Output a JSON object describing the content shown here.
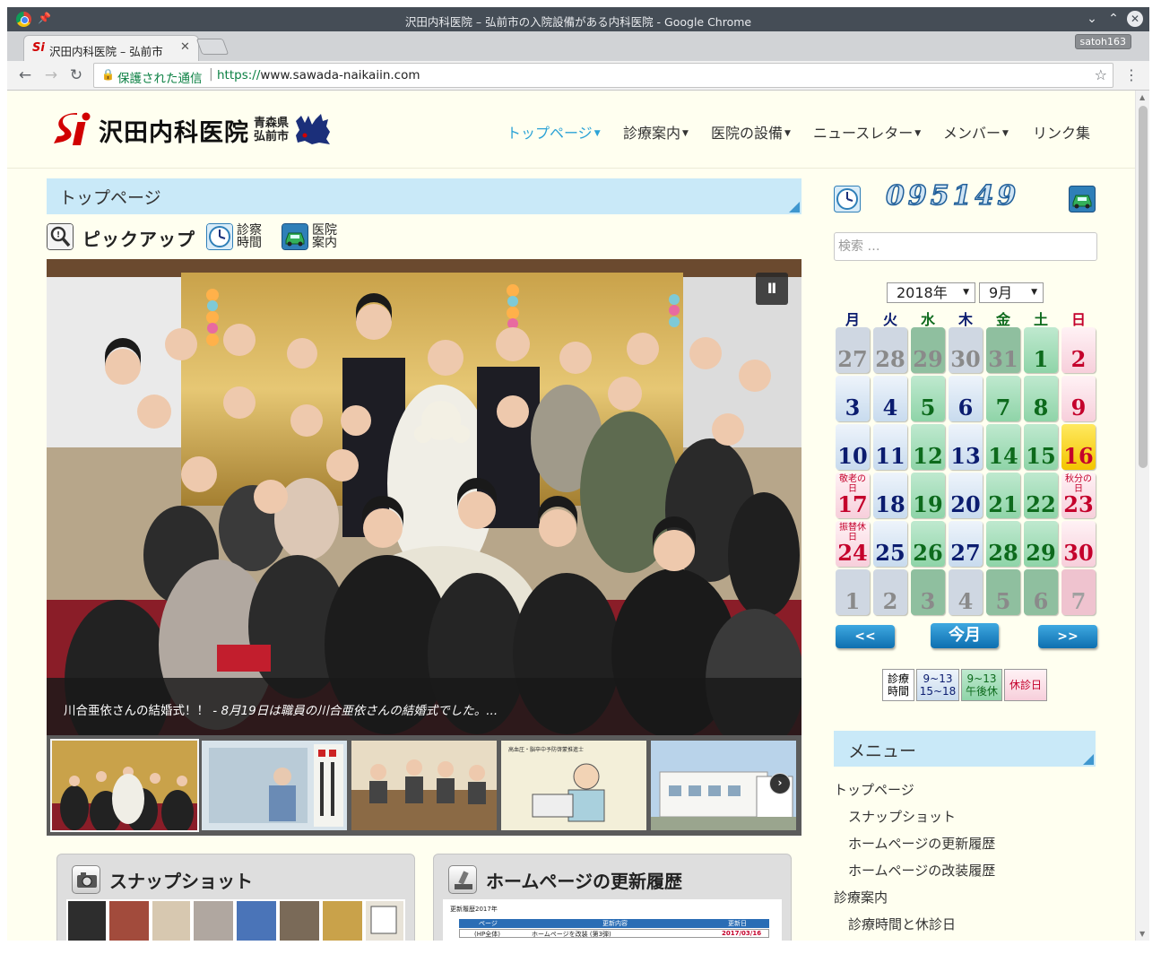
{
  "window": {
    "title": "沢田内科医院 – 弘前市の入院設備がある内科医院 - Google Chrome",
    "tab_title": "沢田内科医院 – 弘前市",
    "profile": "satoh163"
  },
  "address_bar": {
    "security_label": "保護された通信",
    "url_scheme": "https://",
    "url_rest": "www.sawada-naikaiin.com"
  },
  "site": {
    "logo_text": "沢田内科医院",
    "prefecture_line1": "青森県",
    "prefecture_line2": "弘前市",
    "nav": [
      {
        "label": "トップページ",
        "dropdown": true,
        "active": true
      },
      {
        "label": "診療案内",
        "dropdown": true
      },
      {
        "label": "医院の設備",
        "dropdown": true
      },
      {
        "label": "ニュースレター",
        "dropdown": true
      },
      {
        "label": "メンバー",
        "dropdown": true
      },
      {
        "label": "リンク集",
        "dropdown": false
      }
    ]
  },
  "main": {
    "page_title": "トップページ",
    "pickup_label": "ピックアップ",
    "hours_line1": "診察",
    "hours_line2": "時間",
    "clinic_line1": "医院",
    "clinic_line2": "案内",
    "slide_caption_title": "川合亜依さんの結婚式！！",
    "slide_caption_sep": " - ",
    "slide_caption_text": "8月19日は職員の川合亜依さんの結婚式でした。...",
    "cards": [
      {
        "title": "スナップショット"
      },
      {
        "title": "ホームページの更新履歴"
      }
    ],
    "update_table": {
      "heading": "更新履歴2017年",
      "col_page": "ページ",
      "col_content": "更新内容",
      "col_date": "更新日",
      "row_page": "(HP全体)",
      "row_content": "ホームページを改装 (第3弾)",
      "row_date": "2017/03/16"
    }
  },
  "sidebar": {
    "counter": "095149",
    "search_placeholder": "検索 …",
    "calendar": {
      "year": "2018年",
      "month": "9月",
      "weekdays": [
        "月",
        "火",
        "水",
        "木",
        "金",
        "土",
        "日"
      ],
      "weekday_colors": [
        "#0b1c6f",
        "#0b1c6f",
        "#0d6a1c",
        "#0b1c6f",
        "#0d6a1c",
        "#0d6a1c",
        "#c4002b"
      ],
      "weeks": [
        [
          {
            "d": "27",
            "t": "wo"
          },
          {
            "d": "28",
            "t": "wo"
          },
          {
            "d": "29",
            "t": "go"
          },
          {
            "d": "30",
            "t": "wo"
          },
          {
            "d": "31",
            "t": "go"
          },
          {
            "d": "1",
            "t": "g"
          },
          {
            "d": "2",
            "t": "p"
          }
        ],
        [
          {
            "d": "3",
            "t": "w"
          },
          {
            "d": "4",
            "t": "w"
          },
          {
            "d": "5",
            "t": "g"
          },
          {
            "d": "6",
            "t": "w"
          },
          {
            "d": "7",
            "t": "g"
          },
          {
            "d": "8",
            "t": "g"
          },
          {
            "d": "9",
            "t": "p"
          }
        ],
        [
          {
            "d": "10",
            "t": "w"
          },
          {
            "d": "11",
            "t": "w"
          },
          {
            "d": "12",
            "t": "g"
          },
          {
            "d": "13",
            "t": "w"
          },
          {
            "d": "14",
            "t": "g"
          },
          {
            "d": "15",
            "t": "g"
          },
          {
            "d": "16",
            "t": "today"
          }
        ],
        [
          {
            "d": "17",
            "t": "p",
            "h": "敬老の日"
          },
          {
            "d": "18",
            "t": "w"
          },
          {
            "d": "19",
            "t": "g"
          },
          {
            "d": "20",
            "t": "w"
          },
          {
            "d": "21",
            "t": "g"
          },
          {
            "d": "22",
            "t": "g"
          },
          {
            "d": "23",
            "t": "p",
            "h": "秋分の日"
          }
        ],
        [
          {
            "d": "24",
            "t": "p",
            "h": "振替休日"
          },
          {
            "d": "25",
            "t": "w"
          },
          {
            "d": "26",
            "t": "g"
          },
          {
            "d": "27",
            "t": "w"
          },
          {
            "d": "28",
            "t": "g"
          },
          {
            "d": "29",
            "t": "g"
          },
          {
            "d": "30",
            "t": "p"
          }
        ],
        [
          {
            "d": "1",
            "t": "wo"
          },
          {
            "d": "2",
            "t": "wo"
          },
          {
            "d": "3",
            "t": "go"
          },
          {
            "d": "4",
            "t": "wo"
          },
          {
            "d": "5",
            "t": "go"
          },
          {
            "d": "6",
            "t": "go"
          },
          {
            "d": "7",
            "t": "po"
          }
        ]
      ],
      "prev_label": "<<",
      "today_label": "今月",
      "next_label": ">>"
    },
    "legend": {
      "label_line1": "診療",
      "label_line2": "時間",
      "full_line1": "9~13",
      "full_line2": "15~18",
      "half_line1": "9~13",
      "half_line2": "午後休",
      "closed": "休診日"
    },
    "menu_title": "メニュー",
    "menu_items": [
      {
        "label": "トップページ",
        "level": 0
      },
      {
        "label": "スナップショット",
        "level": 1
      },
      {
        "label": "ホームページの更新履歴",
        "level": 1
      },
      {
        "label": "ホームページの改装履歴",
        "level": 1
      },
      {
        "label": "診療案内",
        "level": 0
      },
      {
        "label": "診療時間と休診日",
        "level": 1
      }
    ]
  }
}
